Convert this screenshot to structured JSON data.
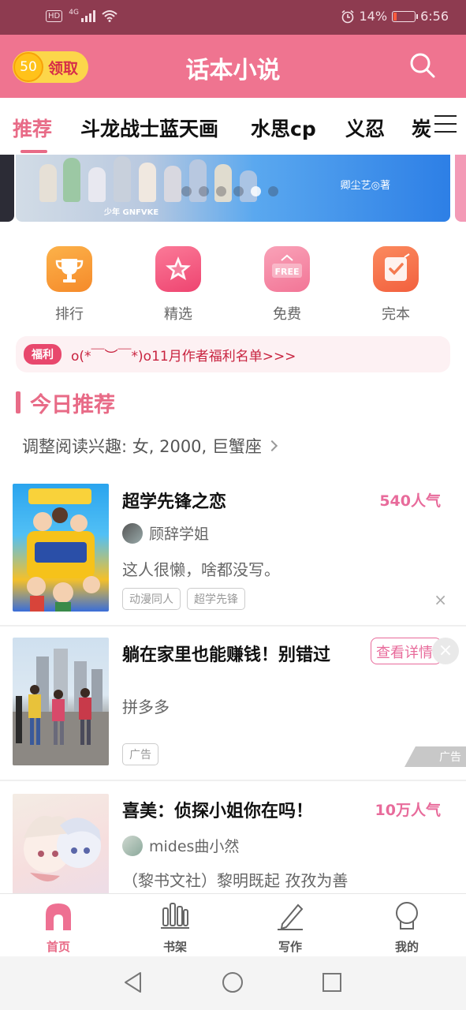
{
  "status_bar": {
    "network_badge": "HD",
    "network_type": "4G",
    "battery_percent": "14%",
    "battery_level": 0.14,
    "time": "6:56"
  },
  "header": {
    "coin_count": "50",
    "claim_label": "领取",
    "app_title": "话本小说",
    "icons": {
      "search": "search-icon",
      "coin": "coin-icon"
    }
  },
  "tabs": {
    "items": [
      {
        "label": "推荐",
        "active": true
      },
      {
        "label": "斗龙战士蓝天画",
        "active": false
      },
      {
        "label": "水思cp",
        "active": false
      },
      {
        "label": "义忍",
        "active": false
      },
      {
        "label": "炭",
        "active": false
      }
    ],
    "menu_icon": "menu-icon"
  },
  "banner": {
    "author_text": "卿尘艺◎著",
    "logo_text": "少年 GNFVKE",
    "page_count": 6,
    "active_index": 4
  },
  "quick_nav": [
    {
      "label": "排行",
      "icon": "trophy-icon",
      "color": "#f79a3a"
    },
    {
      "label": "精选",
      "icon": "star-icon",
      "color": "#f2567b"
    },
    {
      "label": "免费",
      "icon": "free-icon",
      "color": "#f58aa6",
      "badge": "FREE"
    },
    {
      "label": "完本",
      "icon": "check-icon",
      "color": "#f5704f"
    }
  ],
  "welfare": {
    "badge": "福利",
    "text": "o(*￣︶￣*)o11月作者福利名单>>>"
  },
  "section": {
    "title": "今日推荐",
    "interest_text": "调整阅读兴趣: 女, 2000, 巨蟹座"
  },
  "books": [
    {
      "title": "超学先锋之恋",
      "popularity": "540人气",
      "author": "顾辞学姐",
      "description": "这人很懒，啥都没写。",
      "tags": [
        "动漫同人",
        "超学先锋"
      ],
      "close": "×"
    },
    {
      "title": "躺在家里也能赚钱！别错过",
      "action": "查看详情",
      "advertiser": "拼多多",
      "tag": "广告",
      "corner_label": "广告",
      "close": "×"
    },
    {
      "title": "喜美：侦探小姐你在吗！",
      "popularity": "10万人气",
      "author": "mides曲小然",
      "description": "（黎书文社）黎明既起 孜孜为善"
    }
  ],
  "bottom_nav": [
    {
      "label": "首页",
      "icon": "home-icon",
      "active": true
    },
    {
      "label": "书架",
      "icon": "bookshelf-icon",
      "active": false
    },
    {
      "label": "写作",
      "icon": "pen-icon",
      "active": false
    },
    {
      "label": "我的",
      "icon": "profile-icon",
      "active": false
    }
  ],
  "colors": {
    "brand_pink": "#ef7490",
    "accent_pink": "#e86b87",
    "status_bar": "#8e3b50",
    "coin_yellow": "#fcd64a"
  }
}
